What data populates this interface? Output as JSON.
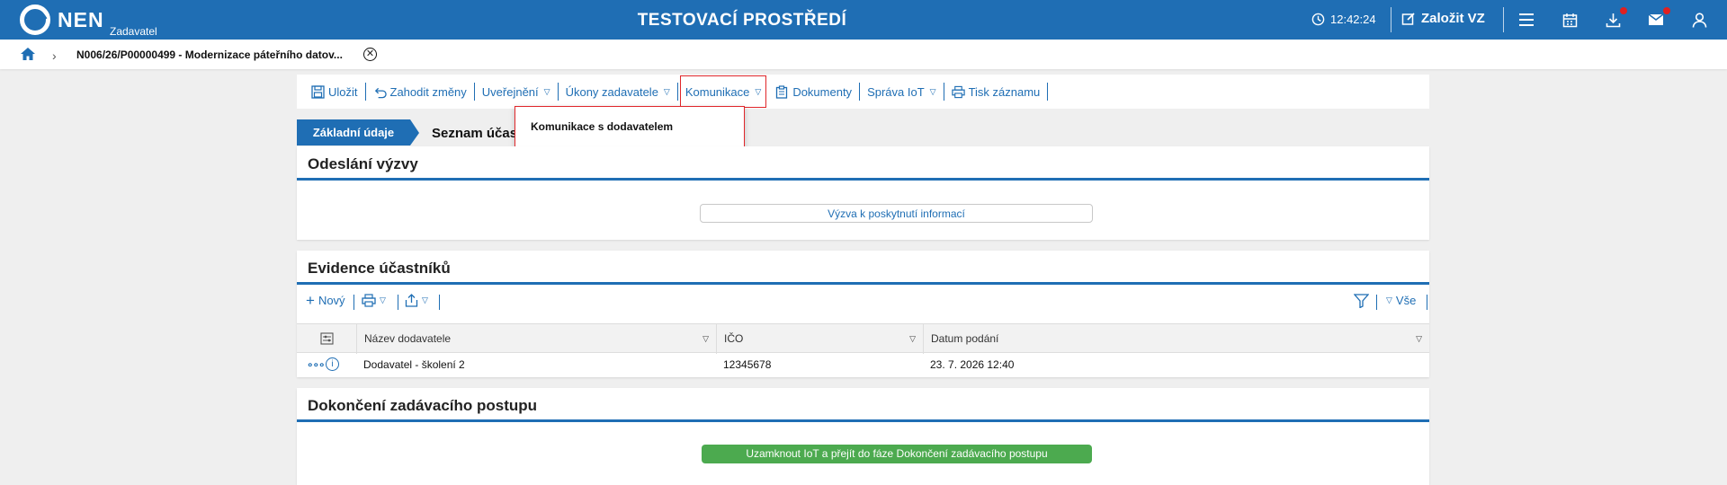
{
  "header": {
    "logo_text": "NEN",
    "logo_sub": "Zadavatel",
    "env_title": "TESTOVACÍ PROSTŘEDÍ",
    "clock": "12:42:24",
    "create_label": "Založit VZ"
  },
  "breadcrumb": {
    "item": "N006/26/P00000499 - Modernizace páteřního datov..."
  },
  "toolbar": {
    "save": "Uložit",
    "discard": "Zahodit změny",
    "publish": "Uveřejnění",
    "actions": "Úkony zadavatele",
    "communication": "Komunikace",
    "documents": "Dokumenty",
    "iot": "Správa IoT",
    "print": "Tisk záznamu"
  },
  "dropdown": {
    "items": [
      "Komunikace s dodavatelem"
    ]
  },
  "tabs": {
    "active": "Základní údaje",
    "second": "Seznam účast"
  },
  "sections": {
    "send_call": {
      "title": "Odeslání výzvy",
      "button": "Výzva k poskytnutí informací"
    },
    "participants": {
      "title": "Evidence účastníků",
      "new_label": "Nový",
      "filter_all": "Vše",
      "columns": [
        "Název dodavatele",
        "IČO",
        "Datum podání"
      ],
      "rows": [
        {
          "name": "Dodavatel - školení 2",
          "ico": "12345678",
          "date": "23. 7. 2026 12:40"
        }
      ]
    },
    "completion": {
      "title": "Dokončení zadávacího postupu",
      "button": "Uzamknout IoT a přejít do fáze Dokončení zadávacího postupu"
    }
  },
  "colors": {
    "primary": "#1f6eb4",
    "highlight": "#e0262a",
    "success": "#4caa4f"
  }
}
